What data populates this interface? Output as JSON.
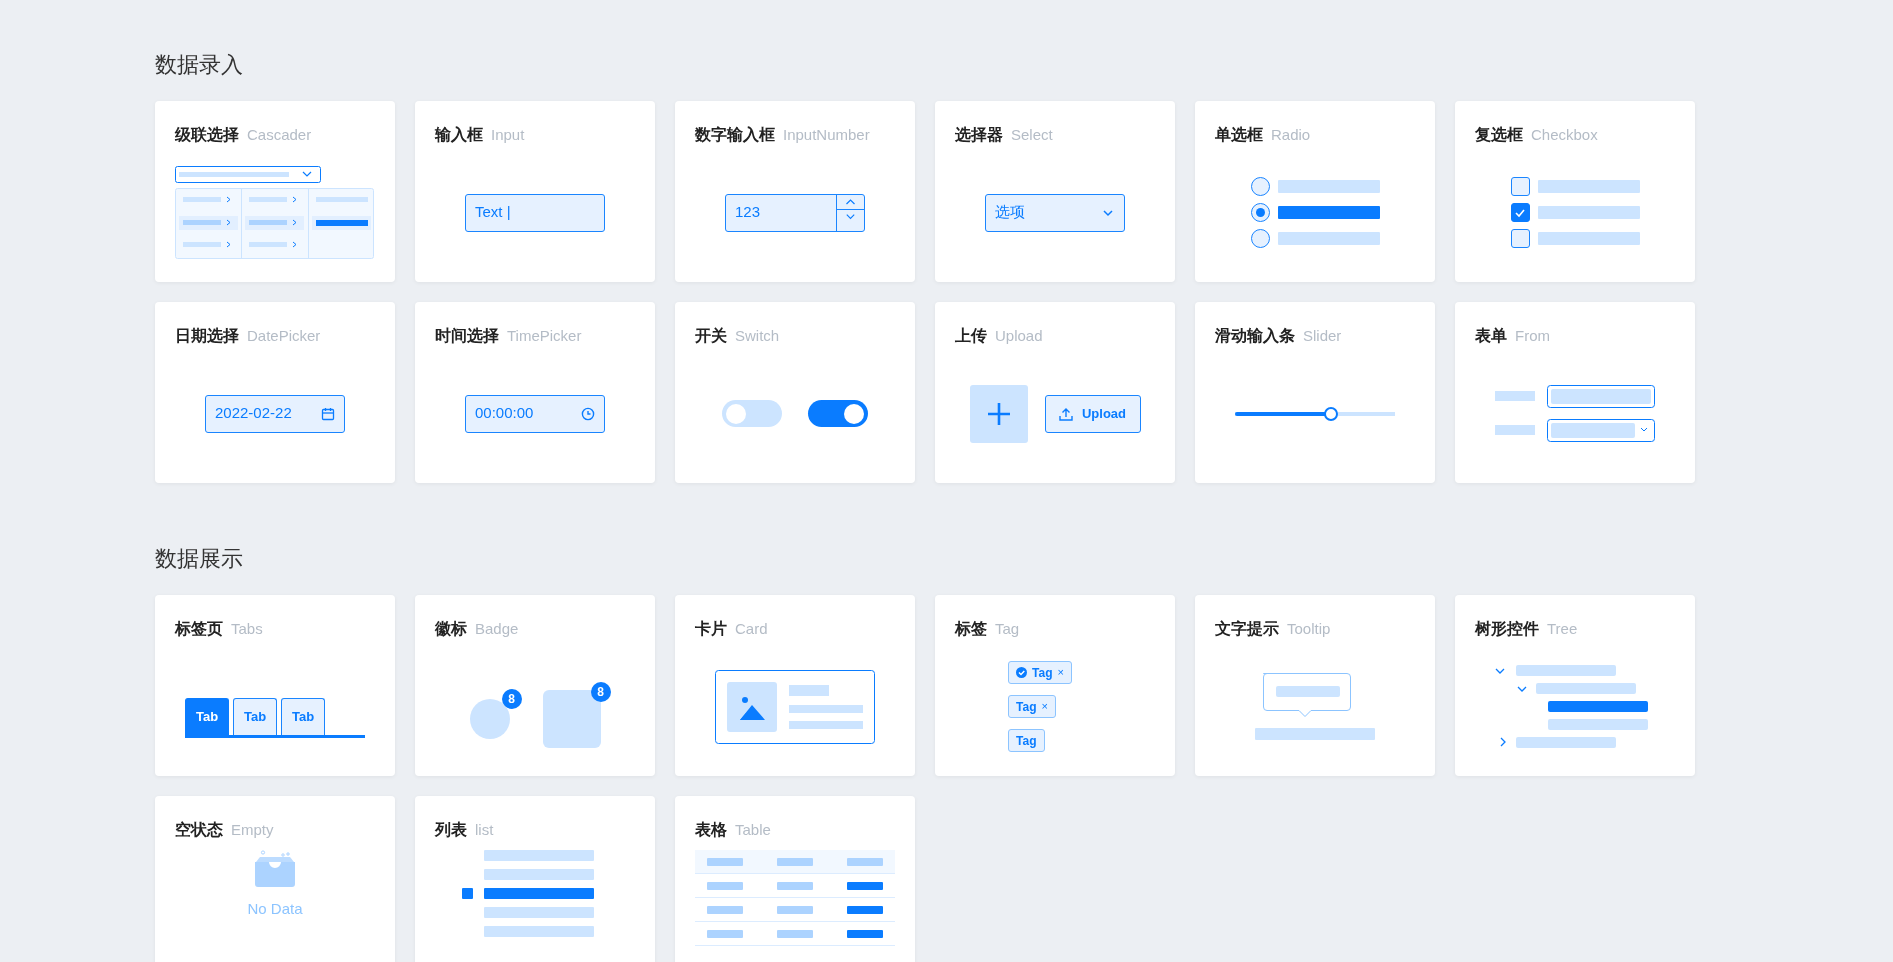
{
  "sections": [
    {
      "title": "数据录入",
      "cards": [
        {
          "kind": "cascader",
          "title": "级联选择",
          "subtitle": "Cascader"
        },
        {
          "kind": "input",
          "title": "输入框",
          "subtitle": "Input",
          "value": "Text |"
        },
        {
          "kind": "input_number",
          "title": "数字输入框",
          "subtitle": "InputNumber",
          "value": "123"
        },
        {
          "kind": "select",
          "title": "选择器",
          "subtitle": "Select",
          "value": "选项"
        },
        {
          "kind": "radio",
          "title": "单选框",
          "subtitle": "Radio",
          "options": [
            {
              "selected": false
            },
            {
              "selected": true
            },
            {
              "selected": false
            }
          ]
        },
        {
          "kind": "checkbox",
          "title": "复选框",
          "subtitle": "Checkbox",
          "options": [
            {
              "checked": false
            },
            {
              "checked": true
            },
            {
              "checked": false
            }
          ]
        },
        {
          "kind": "date_picker",
          "title": "日期选择",
          "subtitle": "DatePicker",
          "value": "2022-02-22"
        },
        {
          "kind": "time_picker",
          "title": "时间选择",
          "subtitle": "TimePicker",
          "value": "00:00:00"
        },
        {
          "kind": "switch",
          "title": "开关",
          "subtitle": "Switch",
          "switches": [
            {
              "on": false
            },
            {
              "on": true
            }
          ]
        },
        {
          "kind": "upload",
          "title": "上传",
          "subtitle": "Upload",
          "button": "Upload"
        },
        {
          "kind": "slider",
          "title": "滑动输入条",
          "subtitle": "Slider",
          "level": 0.6
        },
        {
          "kind": "form",
          "title": "表单",
          "subtitle": "From"
        }
      ]
    },
    {
      "title": "数据展示",
      "cards": [
        {
          "kind": "tabs",
          "title": "标签页",
          "subtitle": "Tabs",
          "tabs": [
            {
              "label": "Tab",
              "selected": true
            },
            {
              "label": "Tab",
              "selected": false
            },
            {
              "label": "Tab",
              "selected": false
            }
          ]
        },
        {
          "kind": "badge",
          "title": "徽标",
          "subtitle": "Badge",
          "badges": [
            "8",
            "8"
          ]
        },
        {
          "kind": "card",
          "title": "卡片",
          "subtitle": "Card"
        },
        {
          "kind": "tag",
          "title": "标签",
          "subtitle": "Tag",
          "tags": [
            {
              "kind": "icon",
              "label": "Tag",
              "close": "×"
            },
            {
              "kind": "plain",
              "label": "Tag",
              "close": "×"
            },
            {
              "kind": "plain",
              "label": "Tag"
            }
          ]
        },
        {
          "kind": "tooltip",
          "title": "文字提示",
          "subtitle": "Tooltip"
        },
        {
          "kind": "tree",
          "title": "树形控件",
          "subtitle": "Tree"
        },
        {
          "kind": "empty",
          "title": "空状态",
          "subtitle": "Empty",
          "text": "No Data"
        },
        {
          "kind": "list",
          "title": "列表",
          "subtitle": "list"
        },
        {
          "kind": "table",
          "title": "表格",
          "subtitle": "Table"
        }
      ]
    }
  ]
}
